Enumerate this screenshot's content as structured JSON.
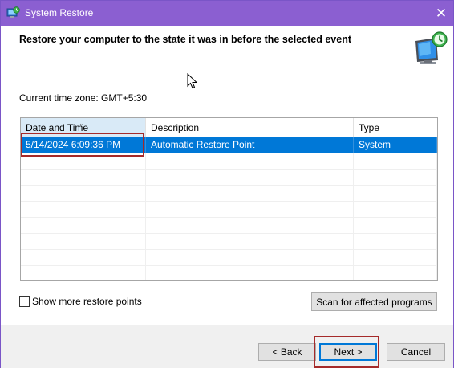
{
  "window": {
    "title": "System Restore",
    "close_glyph": "✕",
    "app_icon": "system-restore-icon",
    "hero_icon": "monitor-restore-icon"
  },
  "heading": "Restore your computer to the state it was in before the selected event",
  "timezone": "Current time zone: GMT+5:30",
  "table": {
    "columns": [
      "Date and Time",
      "Description",
      "Type"
    ],
    "sorted_column": "Date and Time",
    "rows": [
      {
        "date": "5/14/2024 6:09:36 PM",
        "description": "Automatic Restore Point",
        "type": "System",
        "selected": true
      }
    ]
  },
  "show_more": {
    "label": "Show more restore points",
    "checked": false
  },
  "buttons": {
    "scan": "Scan for affected programs",
    "back": "< Back",
    "next": "Next >",
    "cancel": "Cancel"
  },
  "colors": {
    "titlebar": "#8b5fd1",
    "selection": "#0078d7",
    "highlight_annotation": "#a52a2a",
    "header_sorted": "#d9eaf7"
  }
}
